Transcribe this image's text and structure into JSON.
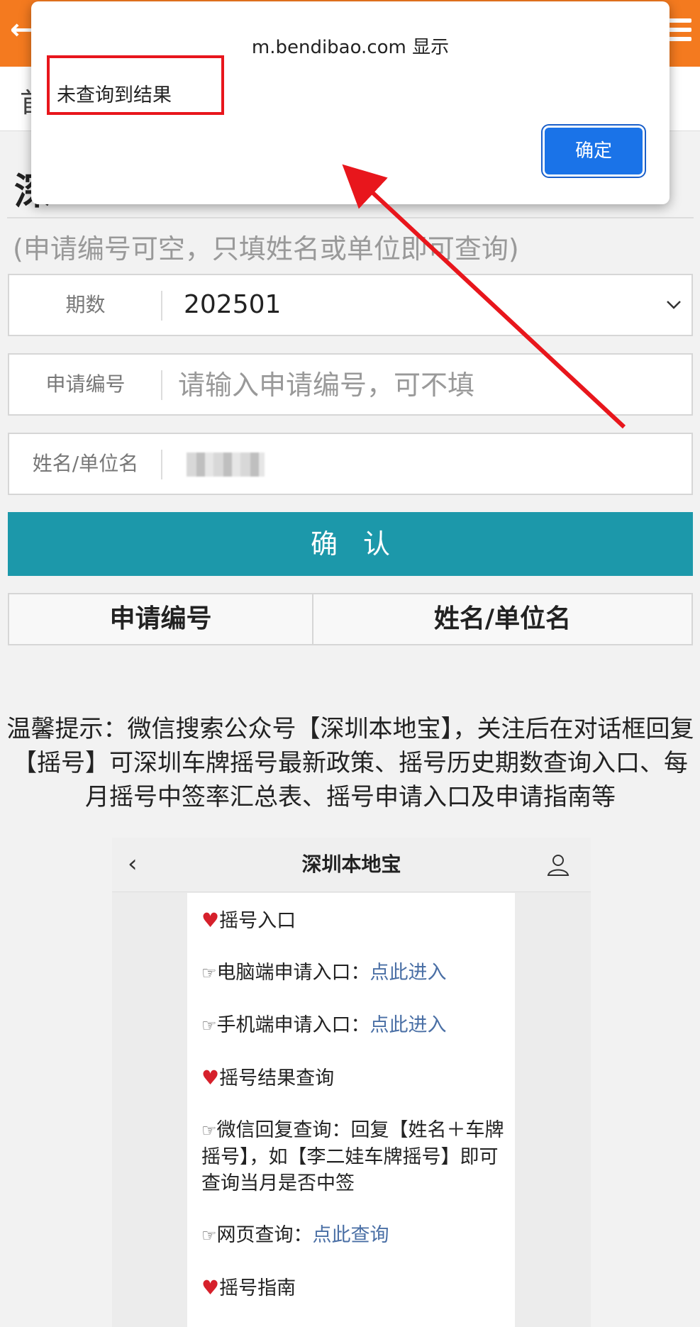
{
  "header": {
    "subnav_text": "首"
  },
  "page": {
    "title": "深",
    "hint": "(申请编号可空，只填姓名或单位即可查询)"
  },
  "form": {
    "period_label": "期数",
    "period_value": "202501",
    "app_no_label": "申请编号",
    "app_no_placeholder": "请输入申请编号，可不填",
    "name_label": "姓名/单位名",
    "confirm_label": "确认"
  },
  "results": {
    "col1": "申请编号",
    "col2": "姓名/单位名"
  },
  "tip": "温馨提示：微信搜索公众号【深圳本地宝】，关注后在对话框回复【摇号】可深圳车牌摇号最新政策、摇号历史期数查询入口、每月摇号中签率汇总表、摇号申请入口及申请指南等",
  "phone": {
    "title": "深圳本地宝",
    "items": {
      "entry_heading": "摇号入口",
      "pc_label": "电脑端申请入口：",
      "pc_link": "点此进入",
      "mobile_label": "手机端申请入口：",
      "mobile_link": "点此进入",
      "result_heading": "摇号结果查询",
      "wechat_query": "微信回复查询：回复【姓名＋车牌摇号】，如【李二娃车牌摇号】即可查询当月是否中签",
      "web_label": "网页查询：",
      "web_link": "点此查询",
      "guide_heading": "摇号指南"
    }
  },
  "dialog": {
    "title": "m.bendibao.com 显示",
    "message": "未查询到结果",
    "ok_label": "确定"
  },
  "colors": {
    "topbar": "#f47a1f",
    "confirm_button": "#1c98aa",
    "dialog_button": "#1a73e8",
    "annotation_red": "#e8161c"
  },
  "icons": [
    "back-arrow-icon",
    "menu-icon",
    "chevron-down-icon",
    "phone-back-icon",
    "user-icon",
    "heart-icon",
    "pointing-hand-icon"
  ]
}
